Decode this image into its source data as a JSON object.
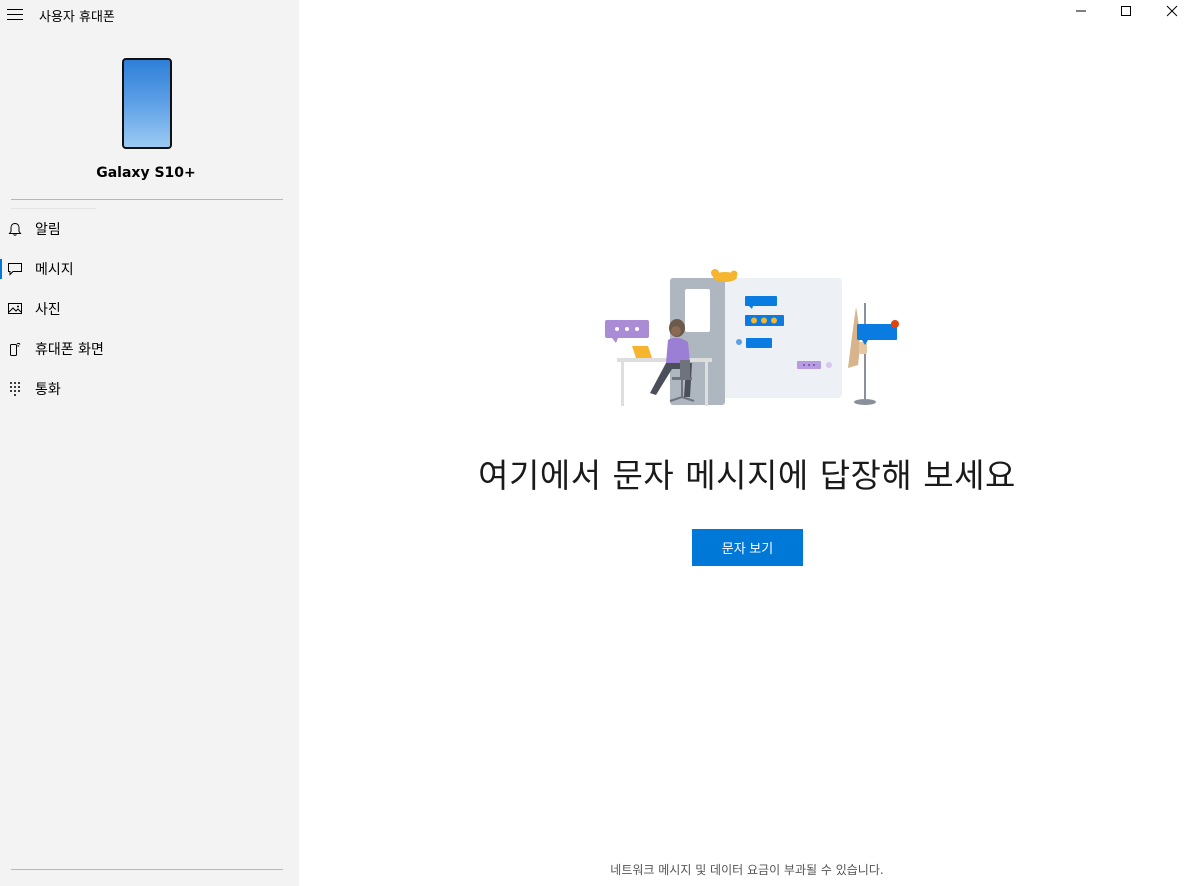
{
  "app": {
    "title": "사용자 휴대폰"
  },
  "device": {
    "name": "Galaxy S10+"
  },
  "nav": {
    "items": [
      {
        "label": "알림",
        "icon": "bell-icon",
        "active": false
      },
      {
        "label": "메시지",
        "icon": "message-icon",
        "active": true
      },
      {
        "label": "사진",
        "icon": "photo-icon",
        "active": false
      },
      {
        "label": "휴대폰 화면",
        "icon": "phone-screen-icon",
        "active": false
      },
      {
        "label": "통화",
        "icon": "dialpad-icon",
        "active": false
      }
    ]
  },
  "window": {
    "controls": [
      "minimize-icon",
      "maximize-icon",
      "close-icon"
    ]
  },
  "main": {
    "headline": "여기에서 문자 메시지에 답장해 보세요",
    "cta_label": "문자 보기",
    "footer_note": "네트워크 메시지 및 데이터 요금이 부과될 수 있습니다."
  },
  "colors": {
    "accent": "#0078d7",
    "sidebar_bg": "#f3f3f3",
    "illustration_purple": "#a98bd6",
    "notification_dot": "#e0430c"
  }
}
